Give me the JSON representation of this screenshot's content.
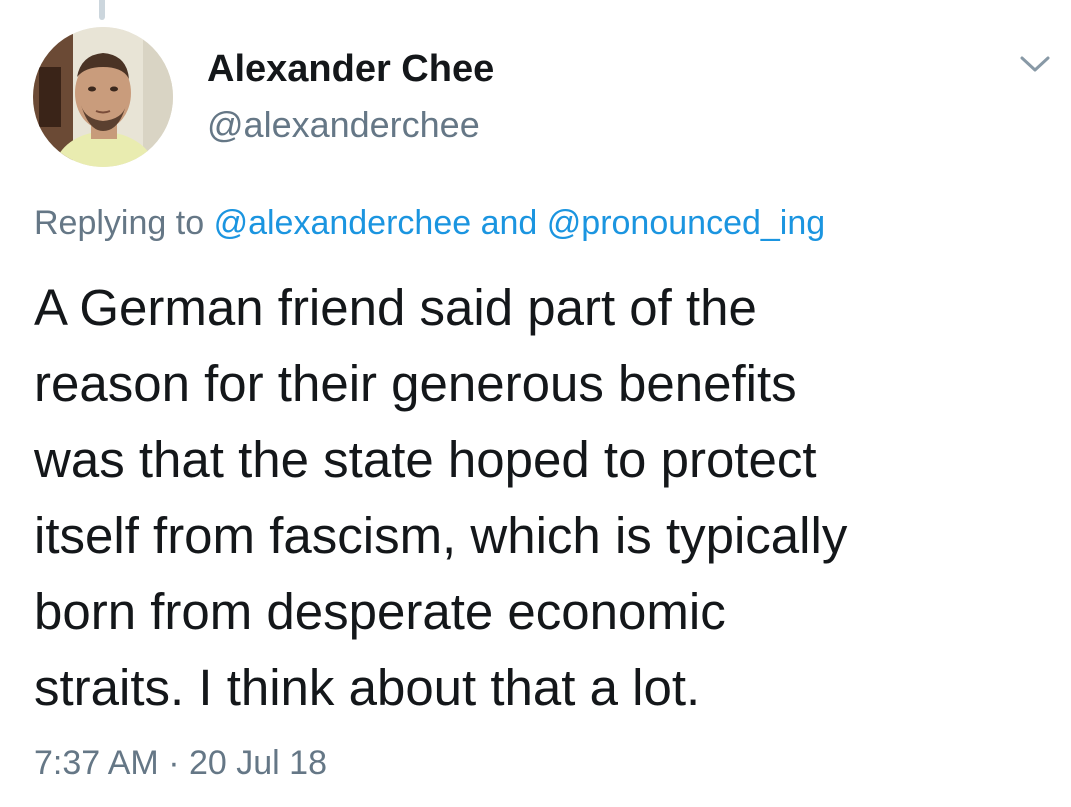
{
  "tweet": {
    "author": {
      "display_name": "Alexander Chee",
      "handle": "@alexanderchee"
    },
    "icons": {
      "avatar": "profile-photo",
      "menu": "chevron-down-icon"
    },
    "reply": {
      "prefix": "Replying to",
      "mention_1": "@alexanderchee",
      "conjunction": "and",
      "mention_2": "@pronounced_ing"
    },
    "text_lines": [
      "A German friend said part of the",
      "reason for their generous benefits",
      "was that the state hoped to protect",
      "itself from fascism, which is typically",
      "born from desperate economic",
      "straits. I think about that a lot."
    ],
    "time": "7:37 AM",
    "separator": "·",
    "date": "20 Jul 18"
  },
  "colors": {
    "text": "#14171a",
    "secondary": "#657786",
    "link": "#1b95e0",
    "thread_line": "#ccd6dd"
  }
}
